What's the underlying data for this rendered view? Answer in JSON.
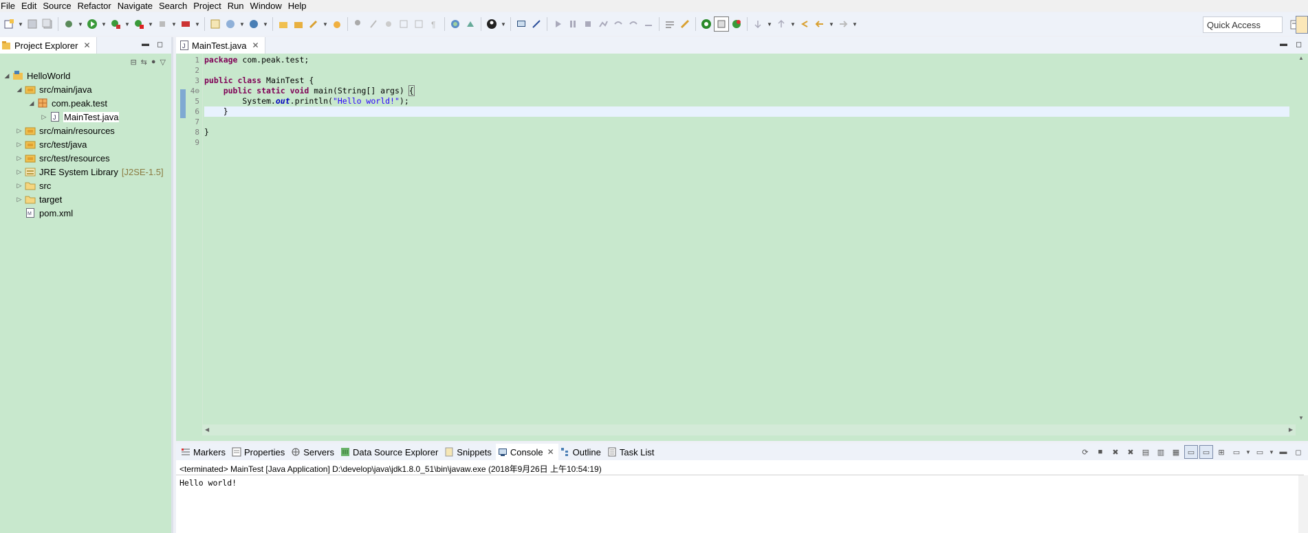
{
  "menu": [
    "File",
    "Edit",
    "Source",
    "Refactor",
    "Navigate",
    "Search",
    "Project",
    "Run",
    "Window",
    "Help"
  ],
  "toolbar": {
    "quick_access_label": "Quick Access"
  },
  "project_explorer": {
    "tab_title": "Project Explorer",
    "tree": [
      {
        "label": "HelloWorld",
        "arrow": "◢",
        "icon": "project-icon",
        "indent": 0
      },
      {
        "label": "src/main/java",
        "arrow": "◢",
        "icon": "source-folder-icon",
        "indent": 1
      },
      {
        "label": "com.peak.test",
        "arrow": "◢",
        "icon": "package-icon",
        "indent": 2
      },
      {
        "label": "MainTest.java",
        "arrow": "▷",
        "icon": "java-file-icon",
        "indent": 3,
        "selected": true
      },
      {
        "label": "src/main/resources",
        "arrow": "▷",
        "icon": "source-folder-icon",
        "indent": 1
      },
      {
        "label": "src/test/java",
        "arrow": "▷",
        "icon": "source-folder-icon",
        "indent": 1
      },
      {
        "label": "src/test/resources",
        "arrow": "▷",
        "icon": "source-folder-icon",
        "indent": 1
      },
      {
        "label": "JRE System Library",
        "extra": "[J2SE-1.5]",
        "arrow": "▷",
        "icon": "library-icon",
        "indent": 1
      },
      {
        "label": "src",
        "arrow": "▷",
        "icon": "folder-icon",
        "indent": 1
      },
      {
        "label": "target",
        "arrow": "▷",
        "icon": "folder-icon",
        "indent": 1
      },
      {
        "label": "pom.xml",
        "arrow": "",
        "icon": "xml-file-icon",
        "indent": 1
      }
    ]
  },
  "editor": {
    "tab_title": "MainTest.java",
    "line_numbers": [
      "1",
      "2",
      "3",
      "4⊖",
      "5",
      "6",
      "7",
      "8",
      "9"
    ],
    "code": {
      "l1_kw": "package",
      "l1_rest": " com.peak.test;",
      "l3_kw": "public class",
      "l3_rest": " MainTest {",
      "l4_indent": "    ",
      "l4_kw": "public static void",
      "l4_rest": " main(String[] args) ",
      "l4_brace": "{",
      "l5_pre": "        System.",
      "l5_field": "out",
      "l5_mid": ".println(",
      "l5_str": "\"Hello world!\"",
      "l5_end": ");",
      "l6": "    }",
      "l8": "}"
    }
  },
  "bottom_panel": {
    "tabs": [
      {
        "label": "Markers",
        "icon": "markers-icon"
      },
      {
        "label": "Properties",
        "icon": "properties-icon"
      },
      {
        "label": "Servers",
        "icon": "servers-icon"
      },
      {
        "label": "Data Source Explorer",
        "icon": "data-source-icon"
      },
      {
        "label": "Snippets",
        "icon": "snippets-icon"
      },
      {
        "label": "Console",
        "icon": "console-icon",
        "active": true
      },
      {
        "label": "Outline",
        "icon": "outline-icon"
      },
      {
        "label": "Task List",
        "icon": "task-list-icon"
      }
    ],
    "console_header": "<terminated> MainTest [Java Application] D:\\develop\\java\\jdk1.8.0_51\\bin\\javaw.exe (2018年9月26日 上午10:54:19)",
    "console_output": "Hello world!"
  },
  "colors": {
    "editor_bg": "#c8e8cd",
    "keyword": "#7f0055",
    "string": "#2a00ff",
    "field": "#0000c0"
  }
}
